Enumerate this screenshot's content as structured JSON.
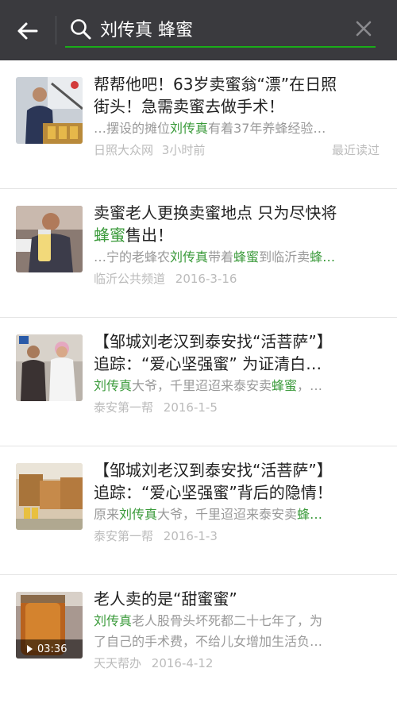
{
  "header": {
    "search_query": "刘传真 蜂蜜",
    "colors": {
      "bar": "#3a3a3e",
      "accent": "#1aad19",
      "highlight": "#3a9a3a"
    }
  },
  "results": [
    {
      "title": "帮帮他吧！63岁卖蜜翁“漂”在日照街头！急需卖蜜去做手术！",
      "title_line1": "帮帮他吧！63岁卖蜜翁“漂”在日照",
      "title_line2": "街头！急需卖蜜去做手术！",
      "snippet_pre": "…摆设的摊位",
      "snippet_hl": "刘传真",
      "snippet_post": "有着37年养蜂经验…",
      "source": "日照大众网",
      "time": "3小时前",
      "read_status": "最近读过"
    },
    {
      "title_line1": "卖蜜老人更换卖蜜地点 只为尽快将",
      "title_line2_hl": "蜂蜜",
      "title_line2_post": "售出！",
      "snippet_pre": "…宁的老蜂农",
      "snippet_hl": "刘传真",
      "snippet_mid": "带着",
      "snippet_hl2": "蜂蜜",
      "snippet_post": "到临沂卖",
      "snippet_hl3": "蜂…",
      "source": "临沂公共频道",
      "time": "2016-3-16"
    },
    {
      "title_line1": "【邹城刘老汉到泰安找“活菩萨”】",
      "title_line2": "追踪：“爱心坚强蜜” 为证清白…",
      "snippet_hl": "刘传真",
      "snippet_mid": "大爷，千里迢迢来泰安卖",
      "snippet_hl2": "蜂蜜",
      "snippet_post": "，…",
      "source": "泰安第一帮",
      "time": "2016-1-5"
    },
    {
      "title_line1": "【邹城刘老汉到泰安找“活菩萨”】",
      "title_line2": "追踪：“爱心坚强蜜”背后的隐情！",
      "snippet_pre": "原来",
      "snippet_hl": "刘传真",
      "snippet_mid": "大爷，千里迢迢来泰安卖",
      "snippet_hl2": "蜂…",
      "source": "泰安第一帮",
      "time": "2016-1-3"
    },
    {
      "title_line1": "老人卖的是“甜蜜蜜”",
      "snippet_hl": "刘传真",
      "snippet_line1_post": "老人股骨头坏死都二十七年了，为",
      "snippet_line2": "了自己的手术费，不给儿女增加生活负…",
      "source": "天天帮办",
      "time": "2016-4-12",
      "video_duration": "03:36"
    }
  ]
}
